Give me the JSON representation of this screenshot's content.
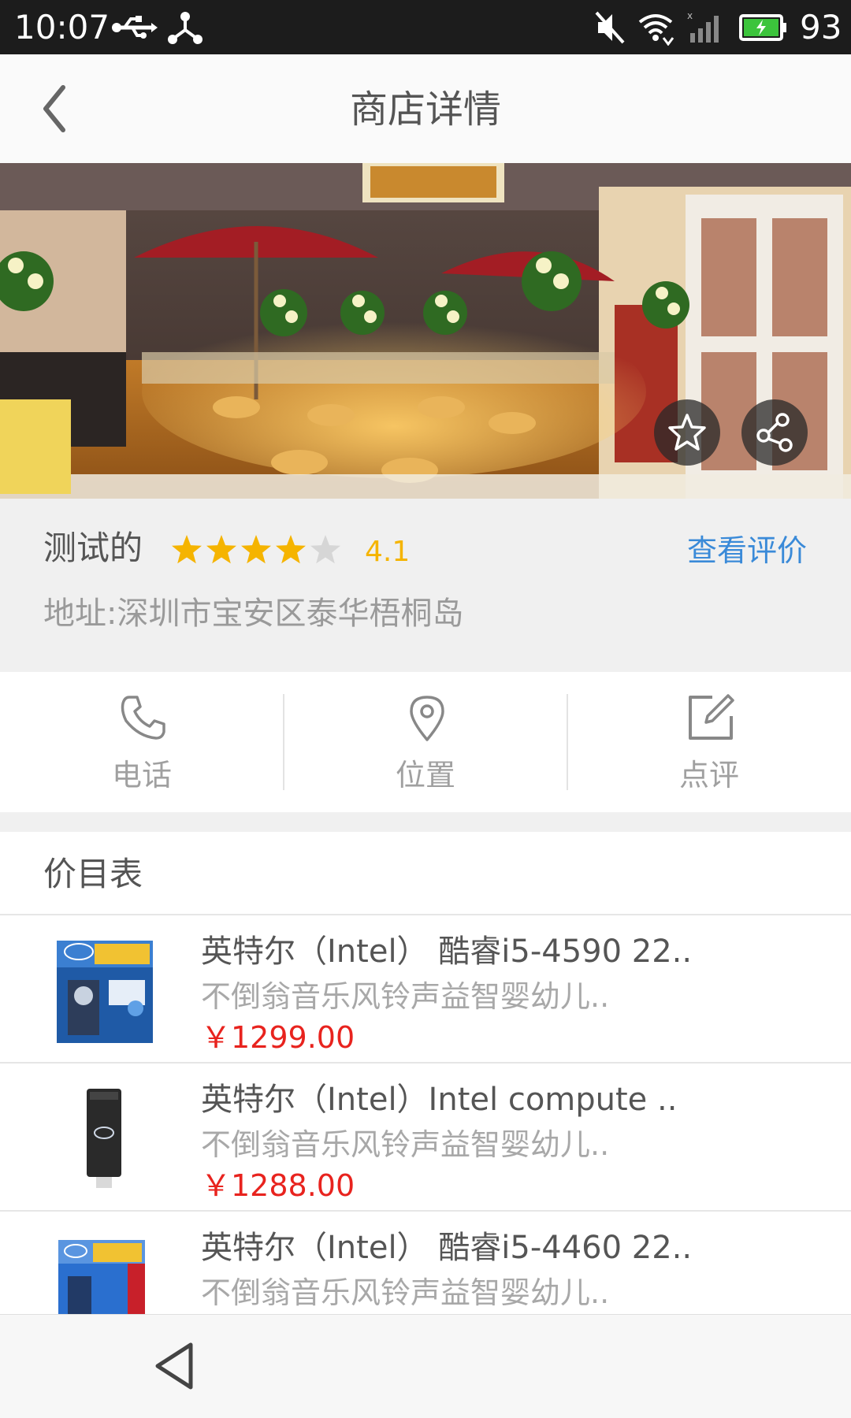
{
  "status_bar": {
    "time": "10:07",
    "battery": "93",
    "icons": [
      "usb-icon",
      "share-nodes-icon",
      "mute-icon",
      "wifi-icon",
      "signal-icon",
      "battery-charging-icon"
    ]
  },
  "header": {
    "title": "商店详情",
    "back_icon": "chevron-left-icon"
  },
  "banner": {
    "favorite_icon": "star-outline-icon",
    "share_icon": "share-icon"
  },
  "shop": {
    "name": "测试的",
    "rating": "4.1",
    "stars_filled": 4,
    "stars_total": 5,
    "reviews_link": "查看评价",
    "address": "地址:深圳市宝安区泰华梧桐岛"
  },
  "actions": [
    {
      "label": "电话",
      "icon": "phone-icon"
    },
    {
      "label": "位置",
      "icon": "location-pin-icon"
    },
    {
      "label": "点评",
      "icon": "edit-icon"
    }
  ],
  "price_list": {
    "title": "价目表",
    "items": [
      {
        "title": "英特尔（Intel） 酷睿i5-4590 22..",
        "desc": "不倒翁音乐风铃声益智婴幼儿..",
        "price": "￥1299.00"
      },
      {
        "title": "英特尔（Intel）Intel compute ..",
        "desc": "不倒翁音乐风铃声益智婴幼儿..",
        "price": "￥1288.00"
      },
      {
        "title": "英特尔（Intel） 酷睿i5-4460 22..",
        "desc": "不倒翁音乐风铃声益智婴幼儿..",
        "price": ""
      }
    ]
  },
  "colors": {
    "accent_blue": "#3a8ad8",
    "star_gold": "#f5b400",
    "price_red": "#e8231e"
  }
}
